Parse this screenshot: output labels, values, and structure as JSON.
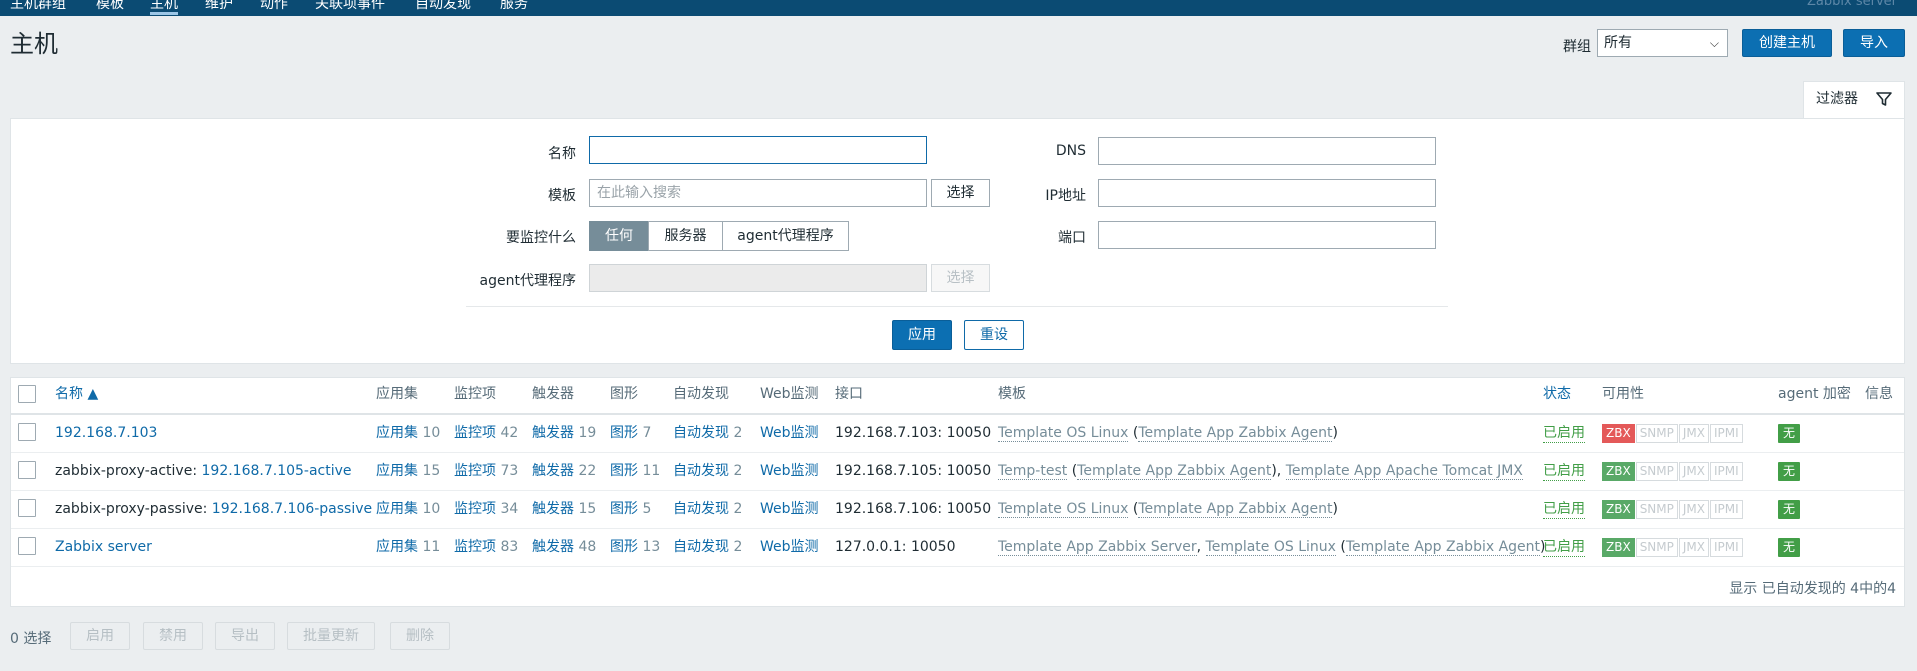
{
  "nav": {
    "items": [
      "主机群组",
      "模板",
      "主机",
      "维护",
      "动作",
      "关联项事件",
      "自动发现",
      "服务"
    ],
    "active_index": 2,
    "brand": "Zabbix server"
  },
  "header": {
    "title": "主机",
    "group_label": "群组",
    "group_value": "所有",
    "create_button": "创建主机",
    "import_button": "导入"
  },
  "filter": {
    "tab_label": "过滤器",
    "labels": {
      "name": "名称",
      "template": "模板",
      "monitored_by": "要监控什么",
      "proxy": "agent代理程序",
      "dns": "DNS",
      "ip": "IP地址",
      "port": "端口"
    },
    "template_placeholder": "在此输入搜索",
    "select_button": "选择",
    "proxy_select_button": "选择",
    "segments": [
      "任何",
      "服务器",
      "agent代理程序"
    ],
    "apply": "应用",
    "reset": "重设"
  },
  "table": {
    "headers": {
      "name": "名称 ▲",
      "apps": "应用集",
      "items": "监控项",
      "triggers": "触发器",
      "graphs": "图形",
      "discovery": "自动发现",
      "web": "Web监测",
      "interface": "接口",
      "templates": "模板",
      "status": "状态",
      "availability": "可用性",
      "encryption": "agent 加密",
      "info": "信息"
    },
    "rows": [
      {
        "name_prefix": "",
        "name_link": "192.168.7.103",
        "apps_label": "应用集",
        "apps_count": "10",
        "items_label": "监控项",
        "items_count": "42",
        "triggers_label": "触发器",
        "triggers_count": "19",
        "graphs_label": "图形",
        "graphs_count": "7",
        "discovery_label": "自动发现",
        "discovery_count": "2",
        "web_label": "Web监测",
        "interface": "192.168.7.103: 10050",
        "tpl1": "Template OS Linux",
        "tpl1_open": " (",
        "tpl1_child": "Template App Zabbix Agent",
        "tpl1_close": ")",
        "tpl2": "",
        "status": "已启用",
        "zbx_ok": false,
        "encryption": "无"
      },
      {
        "name_prefix": "zabbix-proxy-active: ",
        "name_link": "192.168.7.105-active",
        "apps_label": "应用集",
        "apps_count": "15",
        "items_label": "监控项",
        "items_count": "73",
        "triggers_label": "触发器",
        "triggers_count": "22",
        "graphs_label": "图形",
        "graphs_count": "11",
        "discovery_label": "自动发现",
        "discovery_count": "2",
        "web_label": "Web监测",
        "interface": "192.168.7.105: 10050",
        "tpl1": "Temp-test",
        "tpl1_open": " (",
        "tpl1_child": "Template App Zabbix Agent",
        "tpl1_close": "), ",
        "tpl2": "Template App Apache Tomcat JMX",
        "status": "已启用",
        "zbx_ok": true,
        "encryption": "无"
      },
      {
        "name_prefix": "zabbix-proxy-passive: ",
        "name_link": "192.168.7.106-passive",
        "apps_label": "应用集",
        "apps_count": "10",
        "items_label": "监控项",
        "items_count": "34",
        "triggers_label": "触发器",
        "triggers_count": "15",
        "graphs_label": "图形",
        "graphs_count": "5",
        "discovery_label": "自动发现",
        "discovery_count": "2",
        "web_label": "Web监测",
        "interface": "192.168.7.106: 10050",
        "tpl1": "Template OS Linux",
        "tpl1_open": " (",
        "tpl1_child": "Template App Zabbix Agent",
        "tpl1_close": ")",
        "tpl2": "",
        "status": "已启用",
        "zbx_ok": true,
        "encryption": "无"
      },
      {
        "name_prefix": "",
        "name_link": "Zabbix server",
        "apps_label": "应用集",
        "apps_count": "11",
        "items_label": "监控项",
        "items_count": "83",
        "triggers_label": "触发器",
        "triggers_count": "48",
        "graphs_label": "图形",
        "graphs_count": "13",
        "discovery_label": "自动发现",
        "discovery_count": "2",
        "web_label": "Web监测",
        "interface": "127.0.0.1: 10050",
        "tpl0": "Template App Zabbix Server",
        "tpl1": "Template OS Linux",
        "tpl1_open": " (",
        "tpl1_child": "Template App Zabbix Agent",
        "tpl1_close": ")",
        "tpl2": "",
        "status": "已启用",
        "zbx_ok": true,
        "encryption": "无"
      }
    ],
    "availability_badges": [
      "ZBX",
      "SNMP",
      "JMX",
      "IPMI"
    ],
    "footer": "显示 已自动发现的 4中的4"
  },
  "bottom": {
    "selected": "0 选择",
    "actions": [
      "启用",
      "禁用",
      "导出",
      "批量更新",
      "删除"
    ]
  },
  "colors": {
    "nav_bg": "#0b4b73",
    "primary": "#0c6fb2",
    "link": "#0f6aa8",
    "enabled": "#429e47",
    "zbx_error": "#e45959",
    "zbx_ok": "#59a967"
  }
}
